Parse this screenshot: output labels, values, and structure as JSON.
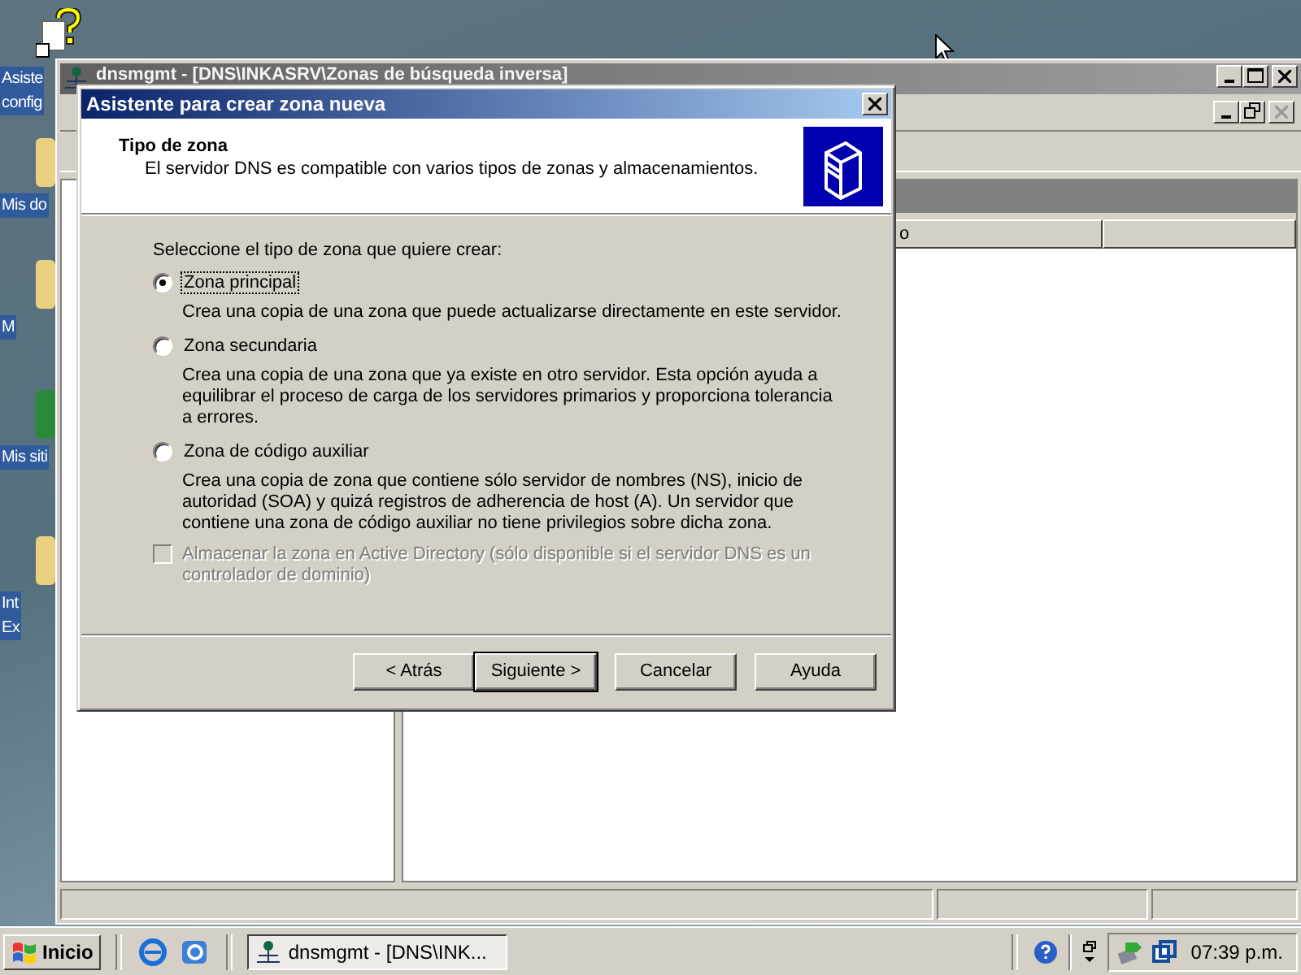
{
  "desktop_icons": [
    {
      "lines": [
        "Asiste",
        "config"
      ]
    },
    {
      "lines": [
        "Mis do"
      ]
    },
    {
      "lines": [
        "M"
      ]
    },
    {
      "lines": [
        "Mis siti"
      ]
    },
    {
      "lines": [
        "Int",
        "Ex"
      ]
    }
  ],
  "main_window": {
    "title": "dnsmgmt - [DNS\\INKASRV\\Zonas de búsqueda inversa]",
    "column_header": "o"
  },
  "dialog": {
    "title": "Asistente para crear zona nueva",
    "heading": "Tipo de zona",
    "subheading": "El servidor DNS es compatible con varios tipos de zonas y almacenamientos.",
    "prompt": "Seleccione el tipo de zona que quiere crear:",
    "options": [
      {
        "label": "Zona principal",
        "description": "Crea una copia de una zona que puede actualizarse directamente en este servidor.",
        "selected": true
      },
      {
        "label": "Zona secundaria",
        "description": "Crea una copia de una zona que ya existe en otro servidor. Esta opción ayuda a equilibrar el proceso de carga de los servidores primarios y proporciona tolerancia a errores.",
        "selected": false
      },
      {
        "label": "Zona de código auxiliar",
        "description": "Crea una copia de zona que contiene sólo servidor de nombres (NS), inicio de autoridad (SOA) y quizá registros de adherencia de host (A). Un servidor que contiene una zona de código auxiliar no tiene privilegios sobre dicha zona.",
        "selected": false
      }
    ],
    "store_checkbox": {
      "label": "Almacenar la zona en Active Directory (sólo disponible si el servidor DNS es un controlador de dominio)",
      "checked": false,
      "disabled": true
    },
    "buttons": [
      {
        "label": "< Atrás",
        "default": false
      },
      {
        "label": "Siguiente >",
        "default": true
      },
      {
        "label": "Cancelar",
        "default": false
      },
      {
        "label": "Ayuda",
        "default": false
      }
    ]
  },
  "taskbar": {
    "start": "Inicio",
    "task": "dnsmgmt - [DNS\\INK...",
    "clock": "07:39 p.m."
  }
}
